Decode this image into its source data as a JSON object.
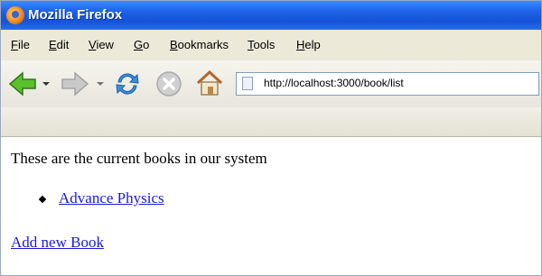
{
  "window": {
    "title": "Mozilla Firefox"
  },
  "menu": [
    {
      "accel": "F",
      "rest": "ile"
    },
    {
      "accel": "E",
      "rest": "dit"
    },
    {
      "accel": "V",
      "rest": "iew"
    },
    {
      "accel": "G",
      "rest": "o"
    },
    {
      "accel": "B",
      "rest": "ookmarks"
    },
    {
      "accel": "T",
      "rest": "ools"
    },
    {
      "accel": "H",
      "rest": "elp"
    }
  ],
  "toolbar": {
    "url": "http://localhost:3000/book/list",
    "icons": [
      "back-arrow-icon",
      "forward-arrow-icon",
      "reload-icon",
      "stop-icon",
      "home-icon"
    ]
  },
  "page": {
    "intro": "These are the current books in our system",
    "books": [
      "Advance Physics"
    ],
    "add_link": "Add new Book"
  },
  "colors": {
    "link": "#1b1bd6",
    "titlebar": "#1e63e8"
  }
}
